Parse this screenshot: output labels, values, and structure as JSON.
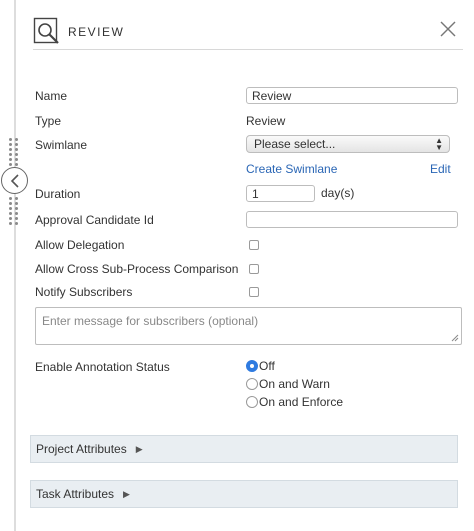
{
  "header": {
    "title": "REVIEW",
    "icon": "review-search-icon",
    "close_icon": "close-icon"
  },
  "form": {
    "name": {
      "label": "Name",
      "value": "Review"
    },
    "type": {
      "label": "Type",
      "value": "Review"
    },
    "swimlane": {
      "label": "Swimlane",
      "selected": "Please select...",
      "create_link": "Create Swimlane",
      "edit_link": "Edit"
    },
    "duration": {
      "label": "Duration",
      "value": "1",
      "unit": "day(s)"
    },
    "approval_candidate": {
      "label": "Approval Candidate Id",
      "value": ""
    },
    "allow_delegation": {
      "label": "Allow Delegation",
      "checked": false
    },
    "allow_cross": {
      "label": "Allow Cross Sub-Process Comparison",
      "checked": false
    },
    "notify_subscribers": {
      "label": "Notify Subscribers",
      "checked": false
    },
    "message": {
      "placeholder": "Enter message for subscribers (optional)"
    },
    "annotation_status": {
      "label": "Enable Annotation Status",
      "options": [
        "Off",
        "On and Warn",
        "On and Enforce"
      ],
      "selected": "Off"
    }
  },
  "sections": {
    "project_attributes": "Project Attributes",
    "task_attributes": "Task Attributes"
  },
  "colors": {
    "link": "#2a66b5",
    "radio_selected": "#2f7be0",
    "section_bg": "#e9eef2"
  }
}
